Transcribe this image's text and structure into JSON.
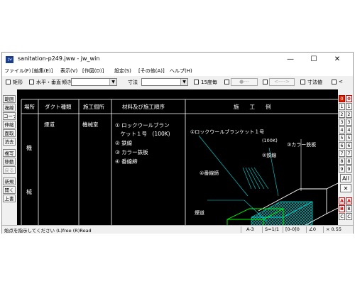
{
  "window": {
    "title": "sanitation-p249.jww - jw_win",
    "icon_text": "jw",
    "minimize": "—",
    "maximize": "☐",
    "close": "✕"
  },
  "menu": [
    "ファイル(F)",
    "[編集(E)]",
    "表示(V)",
    "[作図(D)]",
    "設定(S)",
    "[その他(A)]",
    "ヘルプ(H)"
  ],
  "toolbar": {
    "rect_label": "矩形",
    "hv_label": "水平・垂直",
    "tilt_label": "傾き",
    "dim_label": "寸法",
    "deg15_label": "15度毎",
    "btn1": "●---",
    "btn2": "<---->",
    "dimval_label": "寸法値",
    "last_label": "<"
  },
  "left_tools": [
    "範囲",
    "複線",
    "コーナー",
    "伸縮",
    "面取",
    "消去",
    "複写",
    "移動",
    "戻る",
    "新規",
    "開く",
    "上書"
  ],
  "right_tools": {
    "layer_groups": [
      "0",
      "1",
      "2",
      "3",
      "4",
      "5",
      "6",
      "7",
      "8",
      "9",
      "A",
      "B",
      "C",
      "D",
      "E",
      "F"
    ],
    "layers": [
      "0",
      "1",
      "2",
      "3",
      "4",
      "5",
      "6",
      "7",
      "8",
      "9",
      "A",
      "B",
      "C",
      "D",
      "E",
      "F"
    ],
    "all_label": "All",
    "x_label": "✕"
  },
  "drawing": {
    "headers": [
      "場所",
      "ダクト種類",
      "施工個所",
      "材料及び施工順序",
      "施　　工　　例"
    ],
    "place_chars": [
      "機",
      "械"
    ],
    "duct_type": "煙道",
    "location": "機械室",
    "materials": [
      "① ロックウールブラン",
      "　ケット１号　(100K)",
      "② 鉄線",
      "③ カラー鉄板",
      "④ 番線締"
    ],
    "example_labels": {
      "rockwool": "①ロックウールブランケット１号",
      "rockwool_density": "(100K)",
      "color_plate": "③カラー鉄板",
      "wire": "②鉄線",
      "banding": "④番線締",
      "flue": "煙道"
    }
  },
  "status": {
    "message": "始点を指示してください (L)free (R)Read",
    "paper": "A-3",
    "scale": "S=1/1",
    "layer": "[0-0]0",
    "angle": "∠0",
    "zoom": "× 0.55"
  }
}
